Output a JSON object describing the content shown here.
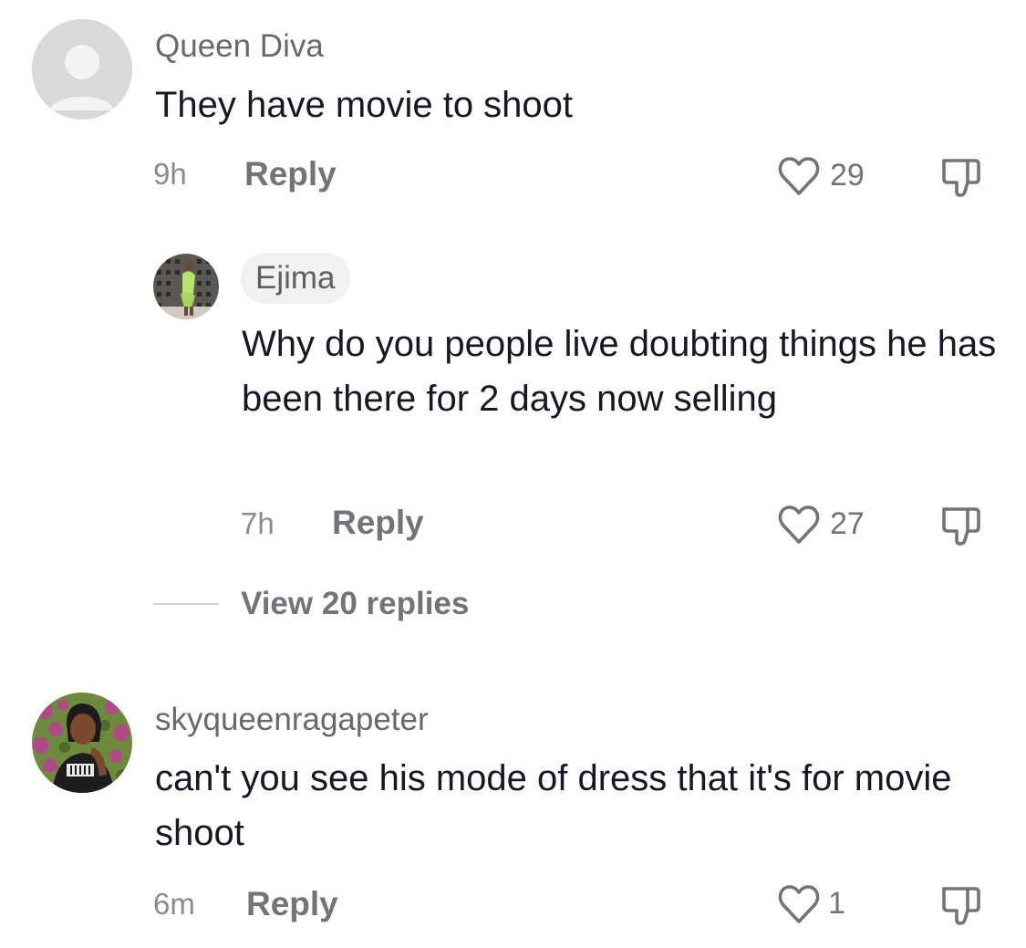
{
  "comments": [
    {
      "username": "Queen Diva",
      "text": "They have movie to shoot",
      "time": "9h",
      "reply_label": "Reply",
      "like_count": "29",
      "avatar": "default-avatar"
    },
    {
      "username": "Ejima",
      "text": "Why do you people live doubting things he has been there for 2 days now selling",
      "time": "7h",
      "reply_label": "Reply",
      "like_count": "27",
      "avatar": "user-photo"
    },
    {
      "username": "skyqueenragapeter",
      "text": "can't you see his mode of dress that it's for movie shoot",
      "time": "6m",
      "reply_label": "Reply",
      "like_count": "1",
      "avatar": "user-photo"
    }
  ],
  "view_replies": "View 20 replies",
  "colors": {
    "text": "#161823",
    "muted": "#737378",
    "username": "#69696c",
    "pill": "#f1f1f2"
  },
  "icons": {
    "like": "heart-outline-icon",
    "dislike": "thumbs-down-icon"
  }
}
